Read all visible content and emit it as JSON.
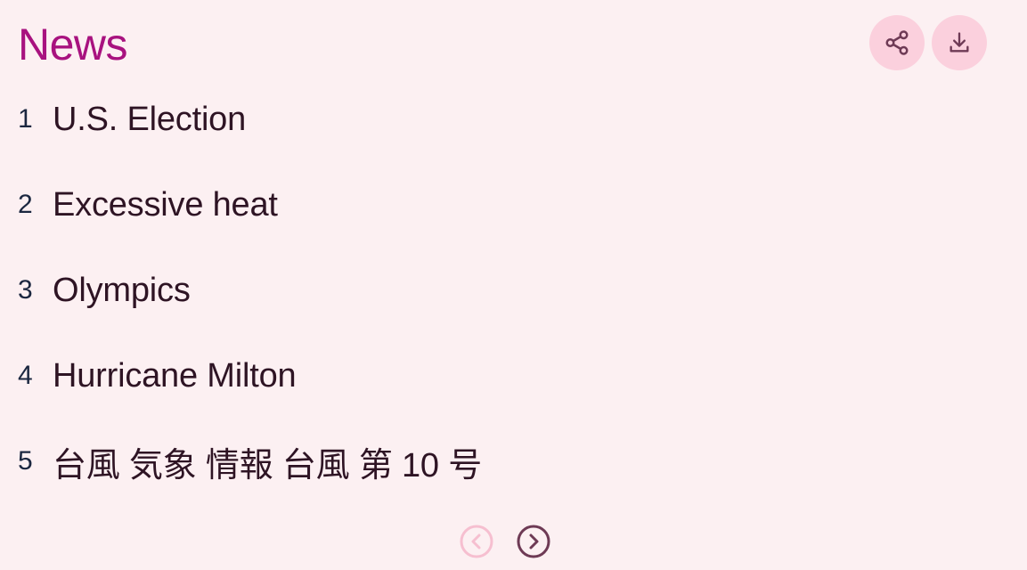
{
  "header": {
    "title": "News"
  },
  "actions": [
    {
      "name": "share-button",
      "icon": "share-icon"
    },
    {
      "name": "download-button",
      "icon": "download-icon"
    }
  ],
  "trends": [
    {
      "rank": "1",
      "topic": "U.S. Election"
    },
    {
      "rank": "2",
      "topic": "Excessive heat"
    },
    {
      "rank": "3",
      "topic": "Olympics"
    },
    {
      "rank": "4",
      "topic": "Hurricane Milton"
    },
    {
      "rank": "5",
      "topic": "台風 気象 情報 台風 第 10 号"
    }
  ],
  "pager": {
    "prev_icon": "chevron-left-circle-icon",
    "next_icon": "chevron-right-circle-icon",
    "prev_disabled": true
  },
  "colors": {
    "background": "#fcf0f2",
    "accent": "#a8127f",
    "button_bg": "#fbd0dd",
    "icon": "#6e3a55",
    "disabled_icon": "#f6bfd0"
  }
}
